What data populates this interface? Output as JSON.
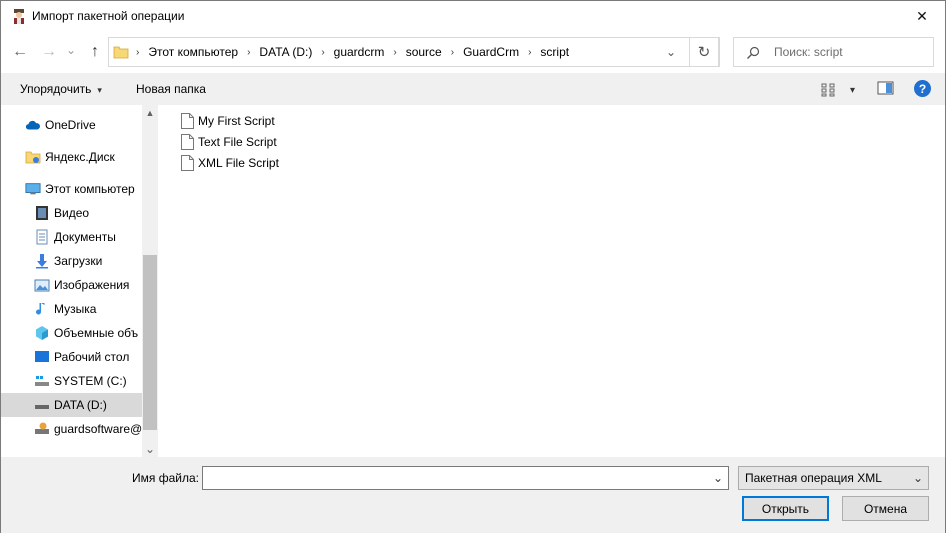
{
  "window": {
    "title": "Импорт пакетной операции",
    "close_glyph": "✕"
  },
  "nav_buttons": {
    "back_glyph": "←",
    "forward_glyph": "→",
    "recent_glyph": "⌄",
    "up_glyph": "↑"
  },
  "address": {
    "crumbs": [
      "Этот компьютер",
      "DATA (D:)",
      "guardcrm",
      "source",
      "GuardCrm",
      "script"
    ],
    "separator": "›",
    "dropdown_glyph": "⌄",
    "refresh_glyph": "↻"
  },
  "search": {
    "placeholder": "Поиск: script"
  },
  "toolbar": {
    "organize_label": "Упорядочить",
    "organize_caret": "▾",
    "new_folder_label": "Новая папка",
    "view_caret": "▾",
    "help_label": "?"
  },
  "nav_pane": {
    "items": [
      {
        "label": "OneDrive",
        "icon": "onedrive-icon"
      },
      {
        "label": "Яндекс.Диск",
        "icon": "yandex-disk-icon"
      },
      {
        "label": "Этот компьютер",
        "icon": "computer-icon"
      },
      {
        "label": "Видео",
        "icon": "video-icon"
      },
      {
        "label": "Документы",
        "icon": "documents-icon"
      },
      {
        "label": "Загрузки",
        "icon": "downloads-icon"
      },
      {
        "label": "Изображения",
        "icon": "pictures-icon"
      },
      {
        "label": "Музыка",
        "icon": "music-icon"
      },
      {
        "label": "Объемные объ",
        "icon": "3d-objects-icon"
      },
      {
        "label": "Рабочий стол",
        "icon": "desktop-icon"
      },
      {
        "label": "SYSTEM (C:)",
        "icon": "drive-c-icon"
      },
      {
        "label": "DATA (D:)",
        "icon": "drive-d-icon"
      },
      {
        "label": "guardsoftware@",
        "icon": "network-drive-icon"
      }
    ],
    "selected": "DATA (D:)",
    "scroll_up_glyph": "▲",
    "scroll_down_glyph": "⌄"
  },
  "files": [
    {
      "name": "My First Script"
    },
    {
      "name": "Text File Script"
    },
    {
      "name": "XML File Script"
    }
  ],
  "footer": {
    "filename_label": "Имя файла:",
    "filename_value": "",
    "filename_caret": "⌄",
    "filetype_value": "Пакетная операция XML",
    "filetype_caret": "⌄",
    "open_label": "Открыть",
    "cancel_label": "Отмена"
  },
  "colors": {
    "accent": "#0078d7",
    "folder": "#f8d775",
    "help": "#1e6fd0",
    "onedrive": "#0364b8"
  }
}
